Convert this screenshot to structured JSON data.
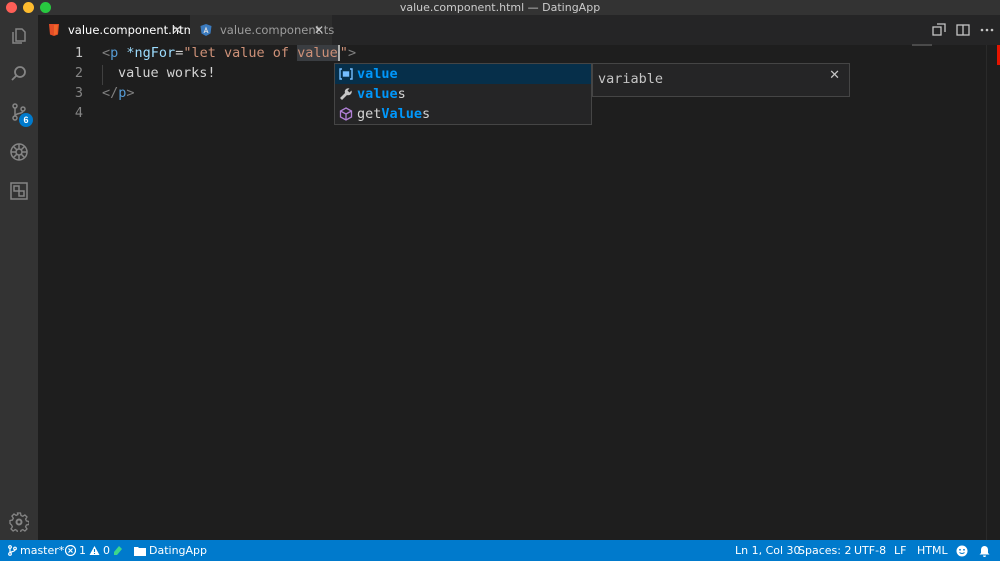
{
  "window": {
    "title": "value.component.html — DatingApp"
  },
  "activity_bar": {
    "items": [
      {
        "name": "explorer",
        "icon": "files-icon"
      },
      {
        "name": "search",
        "icon": "search-icon"
      },
      {
        "name": "source-control",
        "icon": "source-control-icon",
        "badge": "6"
      },
      {
        "name": "debug",
        "icon": "debug-icon"
      },
      {
        "name": "extensions",
        "icon": "extensions-icon"
      }
    ],
    "settings_icon": "gear-icon"
  },
  "tabs": [
    {
      "label": "value.component.html",
      "icon": "html-file-icon",
      "active": true,
      "close": "✕"
    },
    {
      "label": "value.component.ts",
      "icon": "angular-file-icon",
      "active": false,
      "close": "✕"
    }
  ],
  "editor": {
    "line_numbers": [
      "1",
      "2",
      "3",
      "4"
    ],
    "line1": {
      "open": "<",
      "tag": "p",
      "attr": "*ngFor",
      "eq": "=",
      "q": "\"",
      "str1": "let value of ",
      "typed": "value",
      "q2": "\"",
      "close": ">"
    },
    "line2": {
      "text": "value works!"
    },
    "line3": {
      "open": "</",
      "tag": "p",
      "close": ">"
    }
  },
  "suggestions": {
    "items": [
      {
        "icon": "variable-icon",
        "match": "value",
        "rest": "",
        "selected": true
      },
      {
        "icon": "wrench-icon",
        "match": "value",
        "rest": "s",
        "selected": false
      },
      {
        "icon": "method-cube-icon",
        "prefix": "get",
        "match": "Value",
        "rest": "s",
        "selected": false
      }
    ],
    "details": {
      "text": "variable",
      "close": "✕"
    }
  },
  "status_bar": {
    "branch": "master*",
    "errors": "1",
    "warnings": "0",
    "folder": "DatingApp",
    "position": "Ln 1, Col 30",
    "spaces": "Spaces: 2",
    "encoding": "UTF-8",
    "eol": "LF",
    "language": "HTML"
  },
  "colors": {
    "accent": "#007acc",
    "selection": "#062f4a",
    "match": "#0097fb"
  }
}
